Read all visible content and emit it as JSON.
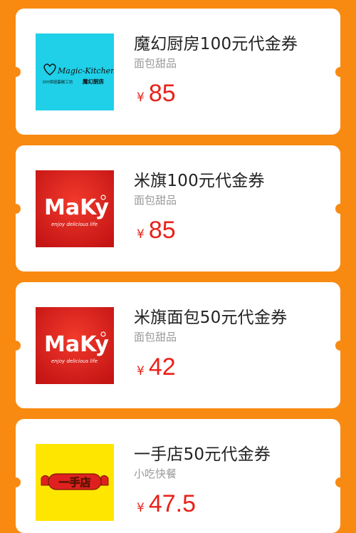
{
  "coupons": [
    {
      "title": "魔幻厨房100元代金券",
      "category": "面包甜品",
      "currency": "¥",
      "price": "85",
      "logo": {
        "icon": "magic-kitchen-logo",
        "text": "Magic-Kitchen",
        "subtext": "DIY烘焙蛋糕工坊",
        "brand_cn": "魔幻厨房",
        "bg": "#1fd0e8"
      }
    },
    {
      "title": "米旗100元代金券",
      "category": "面包甜品",
      "currency": "¥",
      "price": "85",
      "logo": {
        "icon": "maky-logo",
        "text": "MaKy",
        "subtext": "enjoy delicious life",
        "bg": "#d81e1e"
      }
    },
    {
      "title": "米旗面包50元代金券",
      "category": "面包甜品",
      "currency": "¥",
      "price": "42",
      "logo": {
        "icon": "maky-logo",
        "text": "MaKy",
        "subtext": "enjoy delicious life",
        "bg": "#d81e1e"
      }
    },
    {
      "title": "一手店50元代金券",
      "category": "小吃快餐",
      "currency": "¥",
      "price": "47.5",
      "logo": {
        "icon": "yishoudian-logo",
        "text": "一手店",
        "bg": "#ffe600"
      }
    }
  ],
  "colors": {
    "background": "#f88a12",
    "card": "#ffffff",
    "price": "#e8221a",
    "title": "#222222",
    "category": "#9a9a9a"
  }
}
